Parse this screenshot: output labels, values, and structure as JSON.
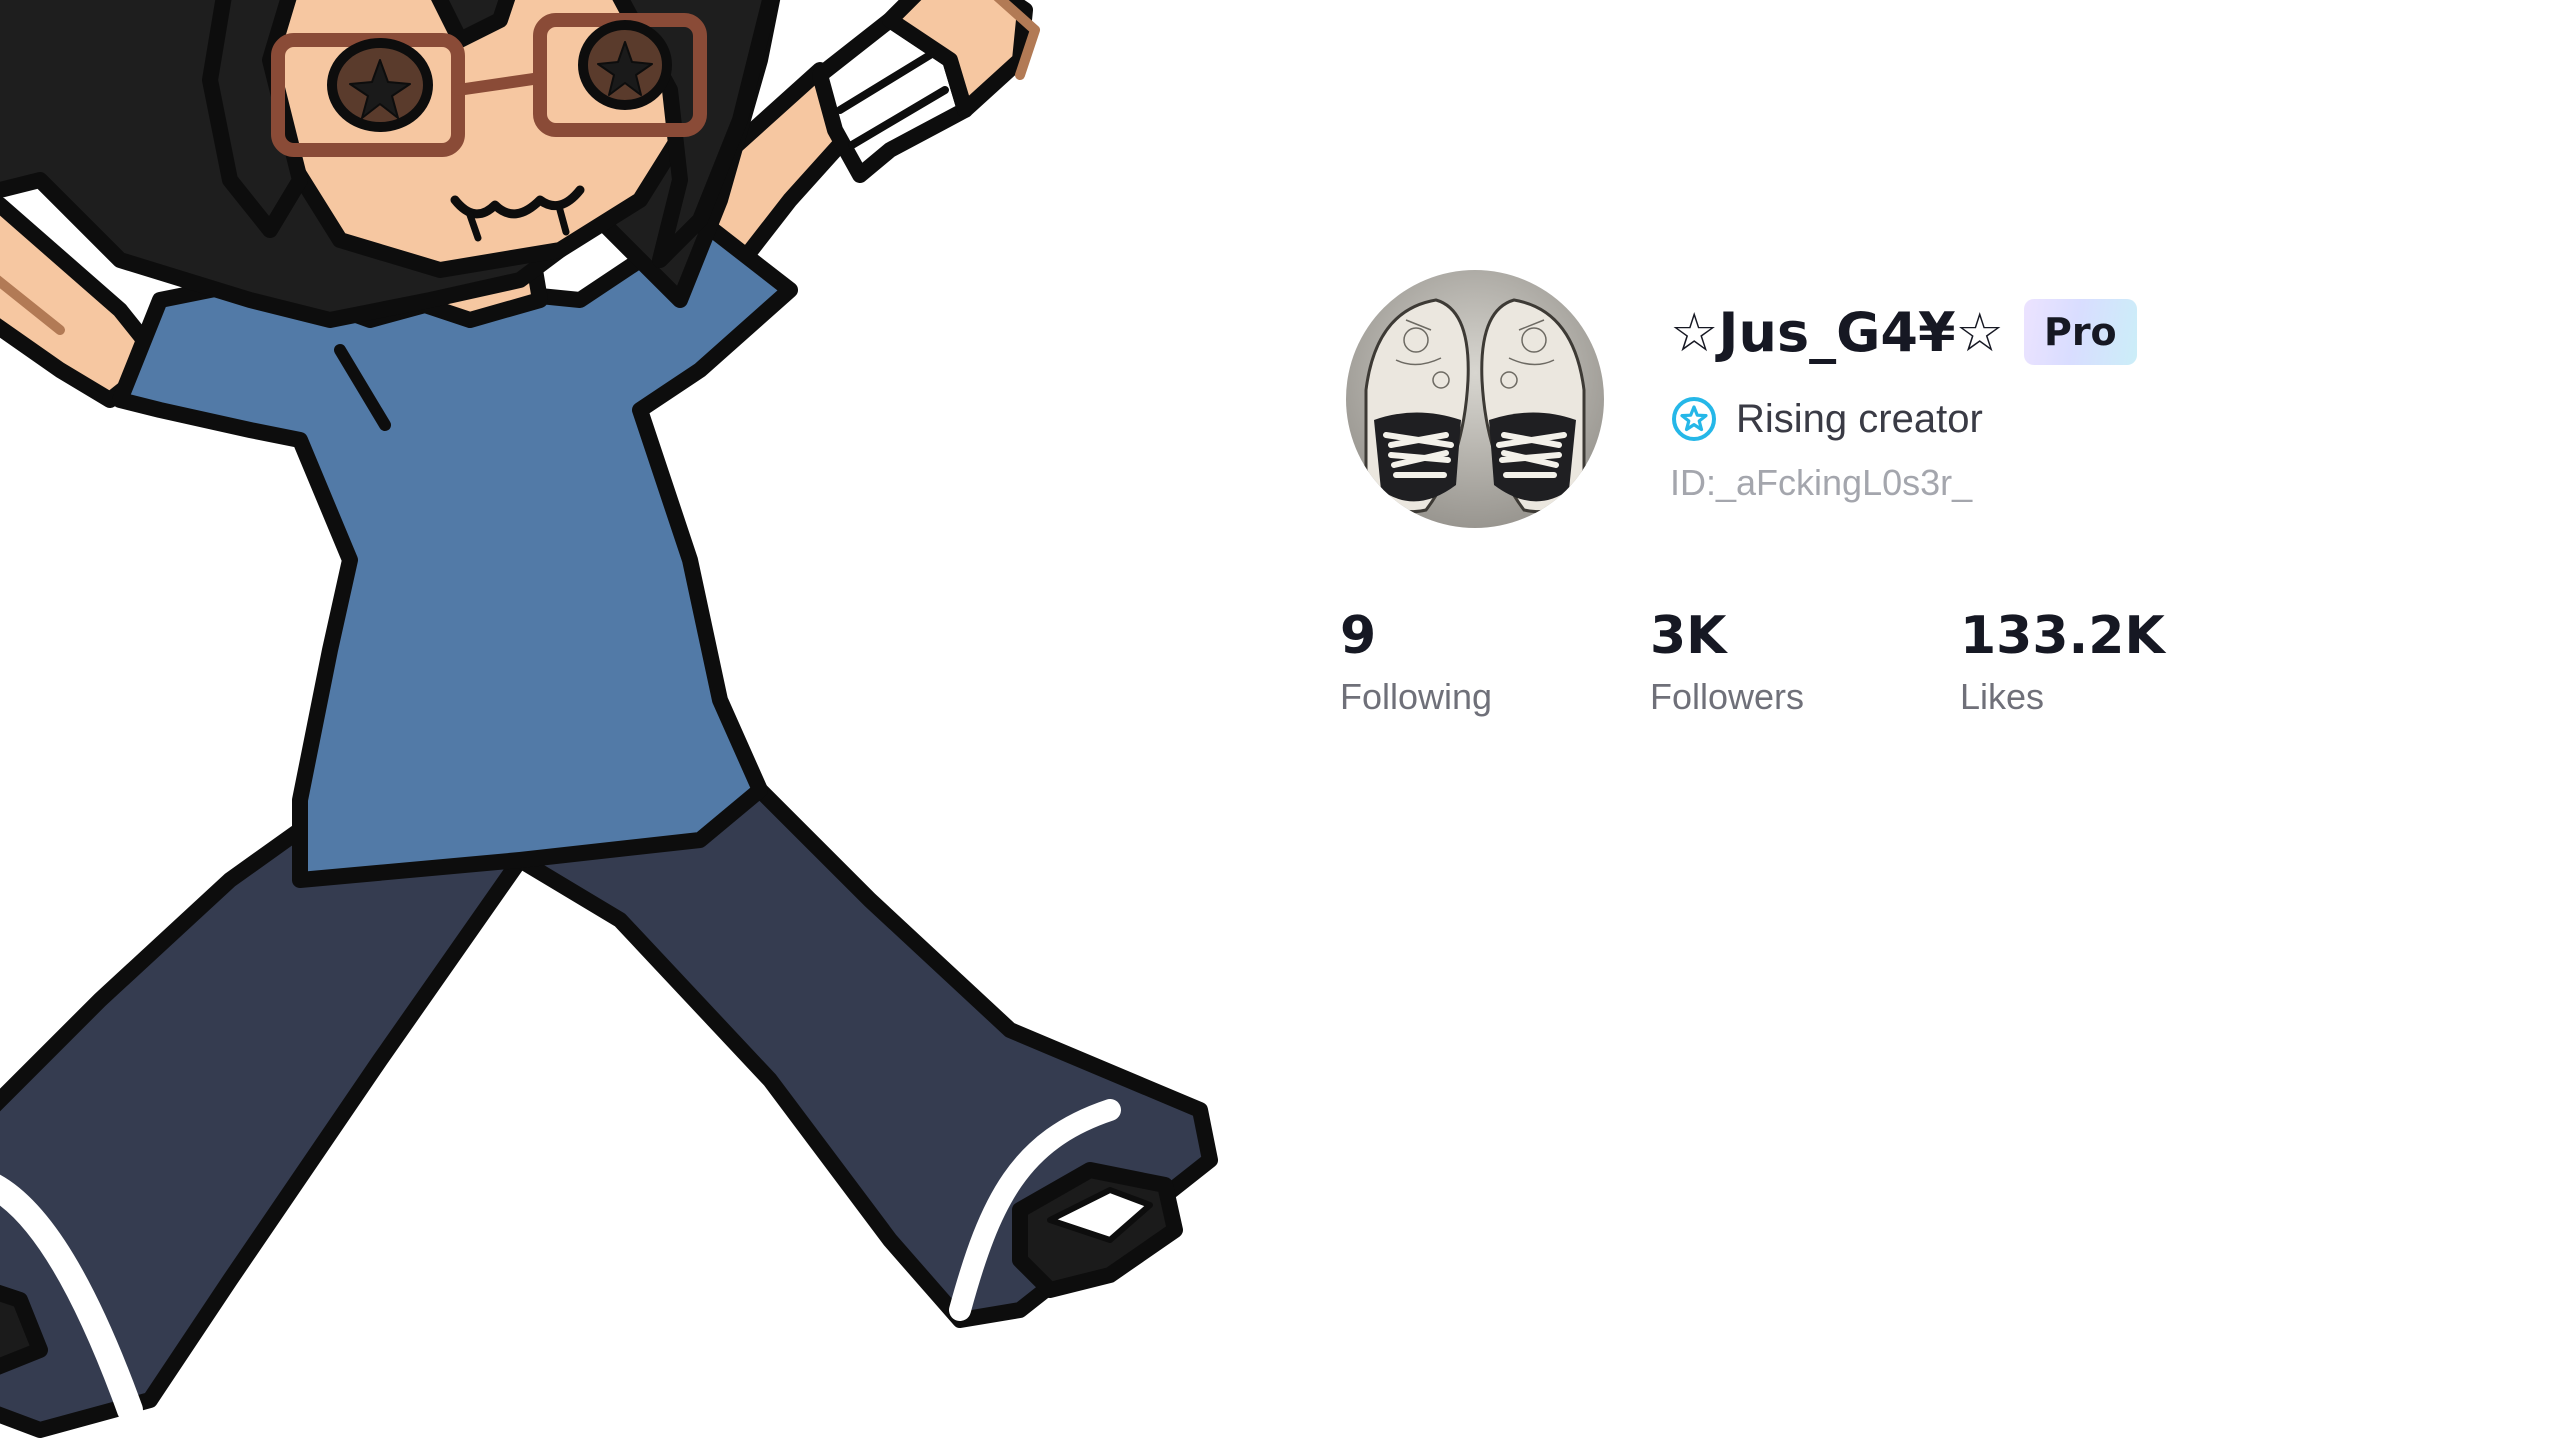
{
  "profile": {
    "display_name": "☆Jus_G4¥☆",
    "badge_label": "Pro",
    "creator_status": "Rising creator",
    "user_id": "ID:_aFckingL0s3r_",
    "avatar_icon": "sneakers-photo",
    "creator_icon": "star-circle-icon"
  },
  "stats": [
    {
      "value": "9",
      "label": "Following"
    },
    {
      "value": "3K",
      "label": "Followers"
    },
    {
      "value": "133.2K",
      "label": "Likes"
    }
  ],
  "colors": {
    "primary_text": "#161823",
    "secondary_text": "#6f7079",
    "muted_text": "#a4a6ad",
    "creator_icon": "#25b7e8",
    "shirt": "#527aa7",
    "pants": "#353c50",
    "skin": "#f6c7a1",
    "hair": "#1e1e1e"
  }
}
